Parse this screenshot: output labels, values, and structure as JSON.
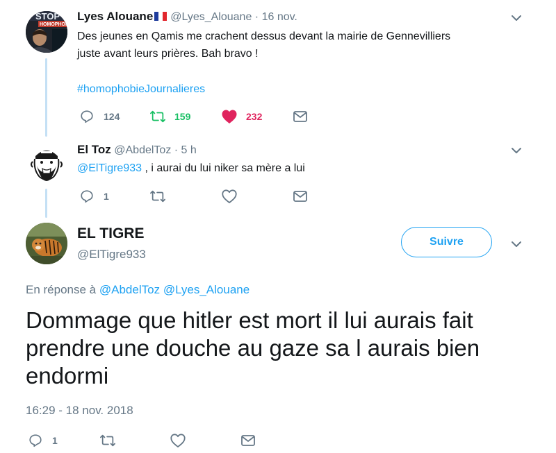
{
  "tweet1": {
    "name": "Lyes Alouane",
    "flag": "🇫🇷",
    "handle": "@Lyes_Alouane",
    "sep": "·",
    "date": "16 nov.",
    "text_line1": "Des jeunes en Qamis me crachent dessus devant la mairie de Gennevilliers",
    "text_line2": "juste avant leurs prières. Bah bravo !",
    "hashtag": "#homophobieJournalieres",
    "replies": "124",
    "retweets": "159",
    "likes": "232",
    "avatar_text": "STOP HOMOPHOBIE"
  },
  "tweet2": {
    "name": "El Toz",
    "handle": "@AbdelToz",
    "sep": "·",
    "date": "5 h",
    "mention": "@ElTigre933",
    "text": " , i aurai du lui niker sa mère a lui",
    "replies": "1"
  },
  "tweet3": {
    "name": "EL TIGRE",
    "handle": "@ElTigre933",
    "follow_label": "Suivre",
    "reply_prefix": "En réponse à",
    "reply_to_1": "@AbdelToz",
    "reply_to_2": "@Lyes_Alouane",
    "text_line1": "Dommage que hitler est mort il lui aurais fait",
    "text_line2": "prendre une douche au gaze sa l aurais bien",
    "text_line3": "endormi",
    "timestamp": "16:29 - 18 nov. 2018",
    "replies": "1"
  },
  "colors": {
    "accent": "#1da1f2",
    "retweet": "#17bf63",
    "like": "#e0245e",
    "muted": "#657786",
    "thread": "#c4e0f5"
  }
}
